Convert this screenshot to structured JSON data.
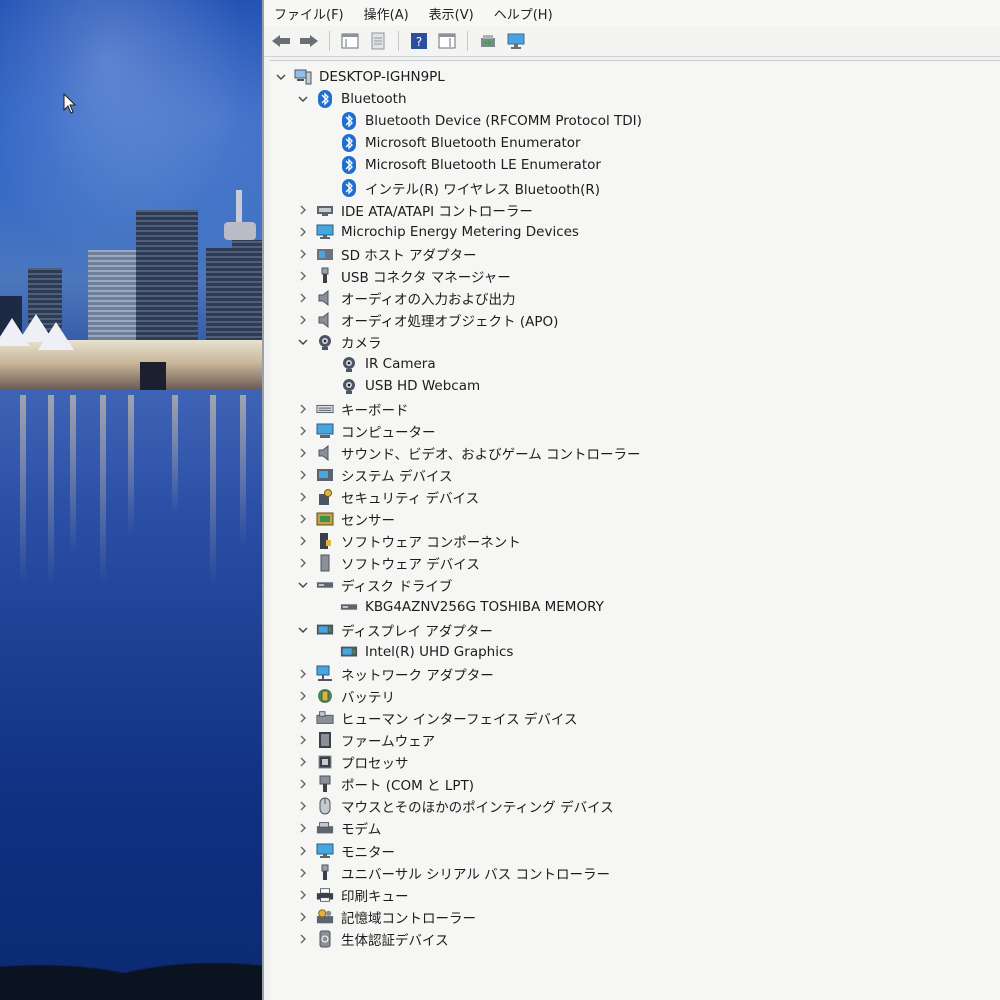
{
  "menu": [
    "ファイル(F)",
    "操作(A)",
    "表示(V)",
    "ヘルプ(H)"
  ],
  "toolbar_icons": [
    "back-arrow-icon",
    "forward-arrow-icon",
    "show-hide-tree-icon",
    "properties-icon",
    "help-icon",
    "action-pane-icon",
    "update-driver-icon",
    "scan-hardware-icon"
  ],
  "tree": {
    "root": "DESKTOP-IGHN9PL",
    "categories": [
      {
        "label": "Bluetooth",
        "icon": "bluetooth-icon",
        "expanded": true,
        "children": [
          "Bluetooth Device (RFCOMM Protocol TDI)",
          "Microsoft Bluetooth Enumerator",
          "Microsoft Bluetooth LE Enumerator",
          "インテル(R) ワイヤレス Bluetooth(R)"
        ]
      },
      {
        "label": "IDE ATA/ATAPI コントローラー",
        "icon": "ide-controller-icon",
        "expanded": false
      },
      {
        "label": "Microchip Energy Metering Devices",
        "icon": "monitor-icon",
        "expanded": false
      },
      {
        "label": "SD ホスト アダプター",
        "icon": "sd-host-icon",
        "expanded": false
      },
      {
        "label": "USB コネクタ マネージャー",
        "icon": "usb-icon",
        "expanded": false
      },
      {
        "label": "オーディオの入力および出力",
        "icon": "speaker-icon",
        "expanded": false
      },
      {
        "label": "オーディオ処理オブジェクト (APO)",
        "icon": "speaker-icon",
        "expanded": false
      },
      {
        "label": "カメラ",
        "icon": "camera-icon",
        "expanded": true,
        "children": [
          "IR Camera",
          "USB HD Webcam"
        ]
      },
      {
        "label": "キーボード",
        "icon": "keyboard-icon",
        "expanded": false
      },
      {
        "label": "コンピューター",
        "icon": "computer-icon",
        "expanded": false
      },
      {
        "label": "サウンド、ビデオ、およびゲーム コントローラー",
        "icon": "speaker-icon",
        "expanded": false
      },
      {
        "label": "システム デバイス",
        "icon": "system-device-icon",
        "expanded": false
      },
      {
        "label": "セキュリティ デバイス",
        "icon": "security-device-icon",
        "expanded": false
      },
      {
        "label": "センサー",
        "icon": "sensor-icon",
        "expanded": false
      },
      {
        "label": "ソフトウェア コンポーネント",
        "icon": "software-component-icon",
        "expanded": false
      },
      {
        "label": "ソフトウェア デバイス",
        "icon": "software-device-icon",
        "expanded": false
      },
      {
        "label": "ディスク ドライブ",
        "icon": "disk-drive-icon",
        "expanded": true,
        "children": [
          "KBG4AZNV256G TOSHIBA MEMORY"
        ]
      },
      {
        "label": "ディスプレイ アダプター",
        "icon": "display-adapter-icon",
        "expanded": true,
        "children": [
          "Intel(R) UHD Graphics"
        ]
      },
      {
        "label": "ネットワーク アダプター",
        "icon": "network-adapter-icon",
        "expanded": false
      },
      {
        "label": "バッテリ",
        "icon": "battery-icon",
        "expanded": false
      },
      {
        "label": "ヒューマン インターフェイス デバイス",
        "icon": "hid-icon",
        "expanded": false
      },
      {
        "label": "ファームウェア",
        "icon": "firmware-icon",
        "expanded": false
      },
      {
        "label": "プロセッサ",
        "icon": "processor-icon",
        "expanded": false
      },
      {
        "label": "ポート (COM と LPT)",
        "icon": "port-icon",
        "expanded": false
      },
      {
        "label": "マウスとそのほかのポインティング デバイス",
        "icon": "mouse-icon",
        "expanded": false
      },
      {
        "label": "モデム",
        "icon": "modem-icon",
        "expanded": false
      },
      {
        "label": "モニター",
        "icon": "monitor-icon",
        "expanded": false
      },
      {
        "label": "ユニバーサル シリアル バス コントローラー",
        "icon": "usb-icon",
        "expanded": false
      },
      {
        "label": "印刷キュー",
        "icon": "printer-icon",
        "expanded": false
      },
      {
        "label": "記憶域コントローラー",
        "icon": "storage-controller-icon",
        "expanded": false
      },
      {
        "label": "生体認証デバイス",
        "icon": "biometric-icon",
        "expanded": false
      }
    ]
  },
  "colors": {
    "window_bg": "#f1f1ef",
    "bluetooth_blue": "#1f6fd1",
    "text": "#1c1c1c"
  }
}
